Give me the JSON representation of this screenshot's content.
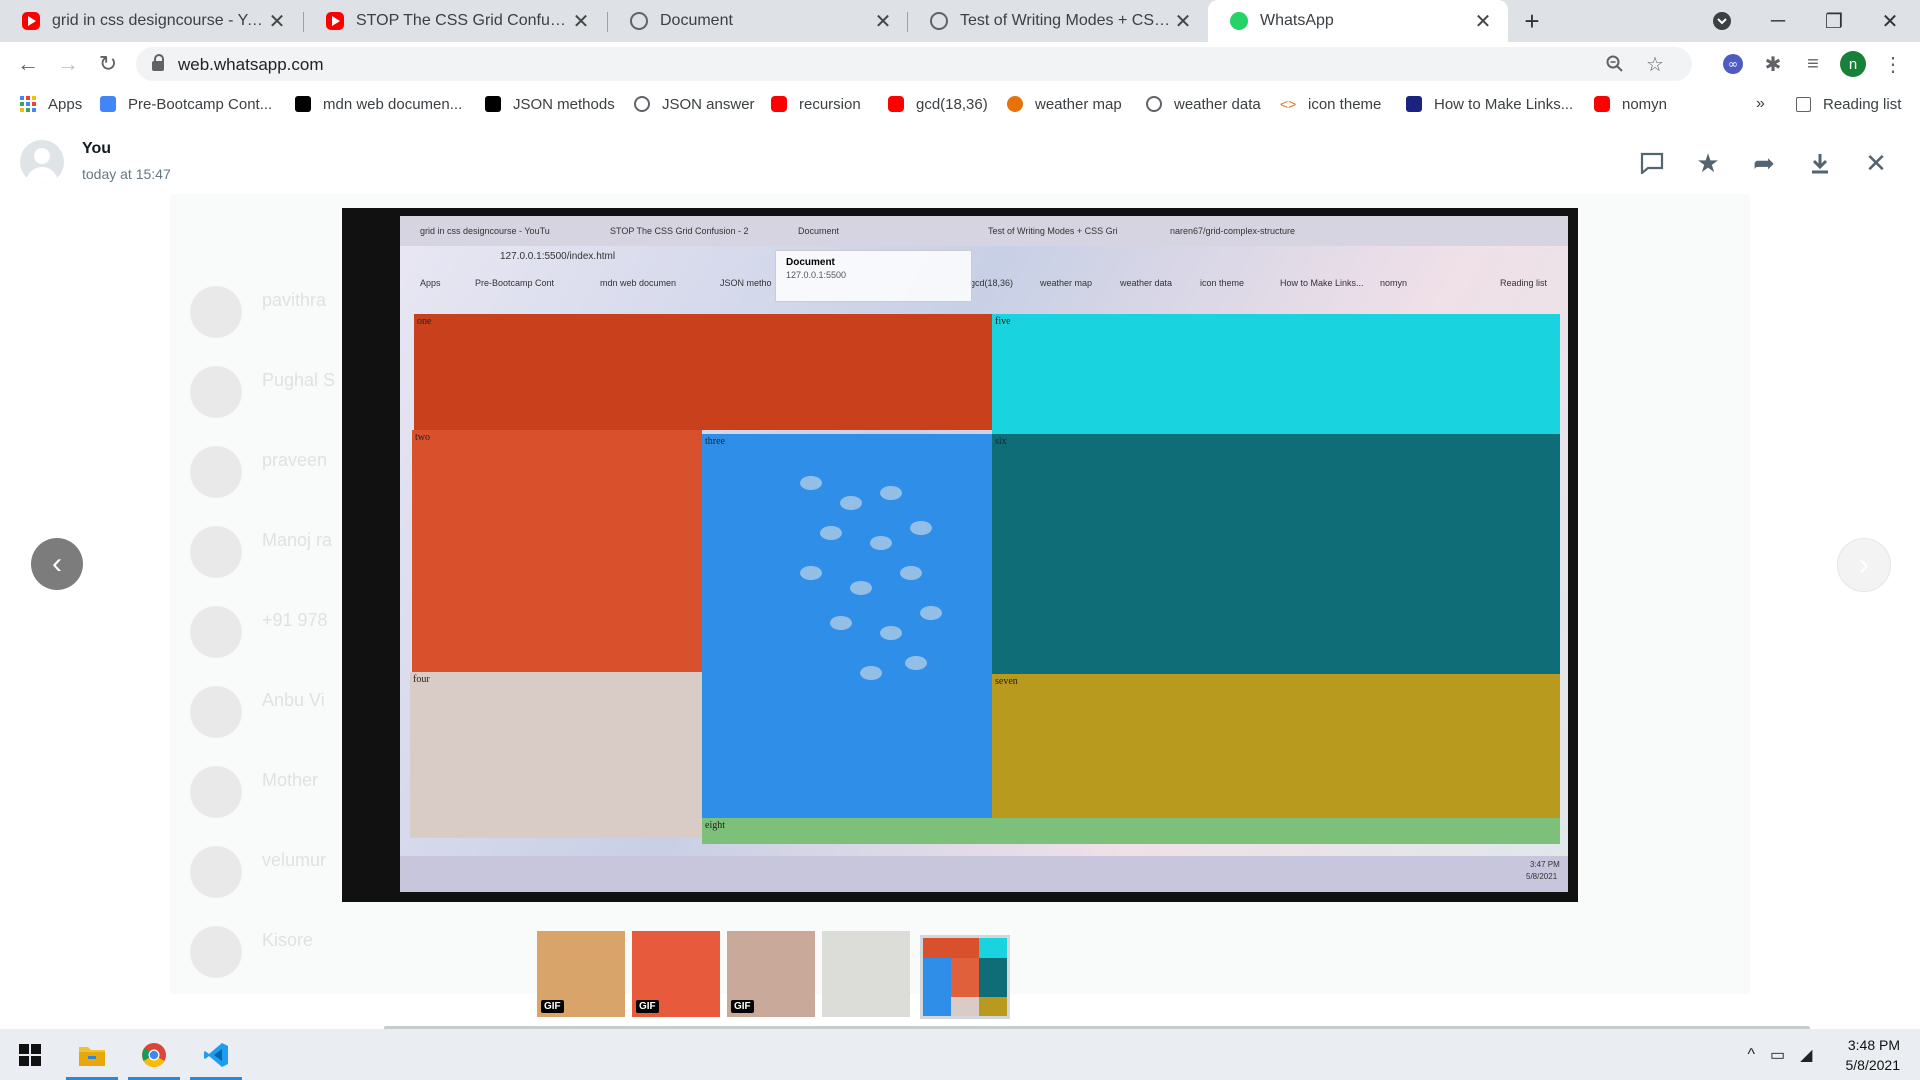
{
  "browser": {
    "tabs": [
      {
        "title": "grid in css designcourse - YouTub",
        "favicon": "youtube-icon",
        "active": false
      },
      {
        "title": "STOP The CSS Grid Confusion - 2",
        "favicon": "youtube-icon",
        "active": false
      },
      {
        "title": "Document",
        "favicon": "globe-icon",
        "active": false
      },
      {
        "title": "Test of Writing Modes + CSS Grid",
        "favicon": "globe-icon",
        "active": false
      },
      {
        "title": "WhatsApp",
        "favicon": "whatsapp-icon",
        "active": true
      }
    ],
    "new_tab": "+",
    "url": "web.whatsapp.com",
    "profile_initial": "n",
    "bookmarks": [
      {
        "label": "Apps",
        "icon": "apps-grid-icon",
        "color": "#4285f4"
      },
      {
        "label": "Pre-Bootcamp Cont...",
        "icon": "docs-icon",
        "color": "#4285f4"
      },
      {
        "label": "mdn web documen...",
        "icon": "mdn-icon",
        "color": "#000000"
      },
      {
        "label": "JSON methods",
        "icon": "dev-icon",
        "color": "#000000"
      },
      {
        "label": "JSON answer",
        "icon": "globe-icon",
        "color": "#5f6368"
      },
      {
        "label": "recursion",
        "icon": "youtube-icon",
        "color": "#ff0000"
      },
      {
        "label": "gcd(18,36)",
        "icon": "youtube-icon",
        "color": "#ff0000"
      },
      {
        "label": "weather map",
        "icon": "weather-icon",
        "color": "#e8710a"
      },
      {
        "label": "weather data",
        "icon": "globe-icon",
        "color": "#5f6368"
      },
      {
        "label": "icon theme",
        "icon": "code-icon",
        "color": "#e8710a"
      },
      {
        "label": "How to Make Links...",
        "icon": "site-icon",
        "color": "#1a237e"
      },
      {
        "label": "nomyn",
        "icon": "youtube-icon",
        "color": "#ff0000"
      }
    ],
    "more_bookmarks": "»",
    "reading_list": "Reading list"
  },
  "viewer": {
    "sender": "You",
    "time": "today at 15:47",
    "background_chats": [
      "pavithra",
      "Pughal S",
      "praveen",
      "Manoj ra",
      "+91 978",
      "Anbu Vi",
      "Mother",
      "velumur",
      "Kisore"
    ]
  },
  "photo": {
    "tabs": [
      "grid in css designcourse - YouTu",
      "STOP The CSS Grid Confusion - 2",
      "Document",
      "Test of Writing Modes + CSS Gri",
      "naren67/grid-complex-structure"
    ],
    "url": "127.0.0.1:5500/index.html",
    "tooltip_title": "Document",
    "tooltip_url": "127.0.0.1:5500",
    "bookmark_labels": [
      "Apps",
      "Pre-Bootcamp Cont",
      "mdn web documen",
      "JSON metho",
      "gcd(18,36)",
      "weather map",
      "weather data",
      "icon theme",
      "How to Make Links...",
      "nomyn",
      "Reading list"
    ],
    "cells": [
      {
        "label": "one",
        "color": "#c8401c"
      },
      {
        "label": "five",
        "color": "#19d4df"
      },
      {
        "label": "two",
        "color": "#d9502c"
      },
      {
        "label": "three",
        "color": "#2f8fe8"
      },
      {
        "label": "six",
        "color": "#0f6d78"
      },
      {
        "label": "four",
        "color": "#d9cbc6"
      },
      {
        "label": "seven",
        "color": "#b89a1e"
      },
      {
        "label": "eight",
        "color": "#7cc07a"
      }
    ],
    "taskbar_time": "3:47 PM",
    "taskbar_date": "5/8/2021"
  },
  "thumbnails": [
    {
      "name": "thumb-bear-gif",
      "badge": "GIF",
      "color": "#d9a46a"
    },
    {
      "name": "thumb-redhair-gif",
      "badge": "GIF",
      "color": "#e85a3c"
    },
    {
      "name": "thumb-hands-gif",
      "badge": "GIF",
      "color": "#c9a99a"
    },
    {
      "name": "thumb-paper",
      "badge": "",
      "color": "#dcdcd8"
    },
    {
      "name": "thumb-grid-screenshot",
      "badge": "",
      "color": "#3c9ad6"
    }
  ],
  "taskbar": {
    "time": "3:48 PM",
    "date": "5/8/2021"
  }
}
